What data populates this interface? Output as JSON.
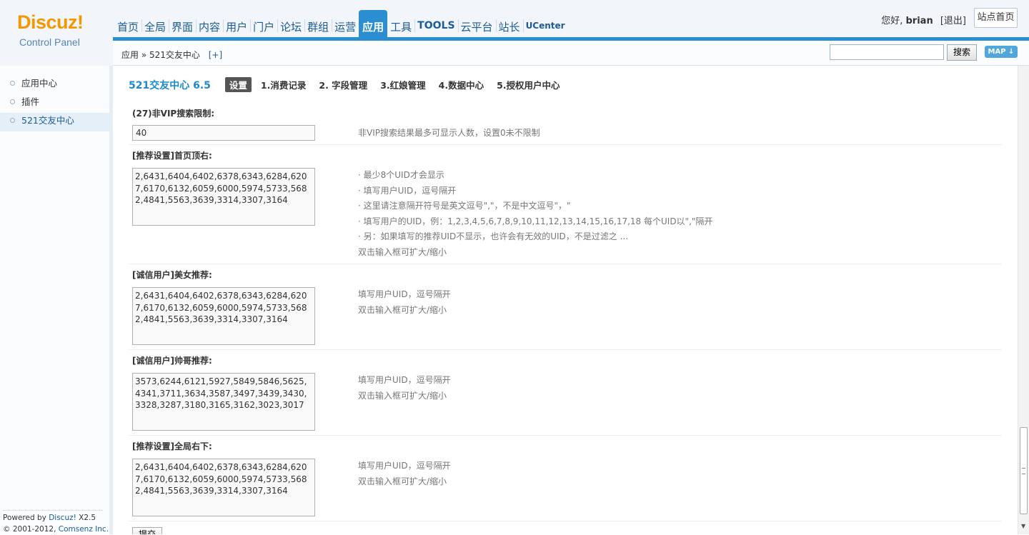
{
  "logo": {
    "brand": "Discuz!",
    "subtitle": "Control Panel"
  },
  "nav": {
    "items": [
      {
        "label": "首页"
      },
      {
        "label": "全局"
      },
      {
        "label": "界面"
      },
      {
        "label": "内容"
      },
      {
        "label": "用户"
      },
      {
        "label": "门户"
      },
      {
        "label": "论坛"
      },
      {
        "label": "群组"
      },
      {
        "label": "运营"
      },
      {
        "label": "应用"
      },
      {
        "label": "工具"
      },
      {
        "label": "TOOLS"
      },
      {
        "label": "云平台"
      },
      {
        "label": "站长"
      },
      {
        "label": "UCenter"
      }
    ],
    "active": "应用"
  },
  "user": {
    "greeting": "您好,",
    "name": "brian",
    "logout": "[退出]",
    "site_home": "站点首页"
  },
  "breadcrumb": {
    "section": "应用",
    "sep": "»",
    "current": "521交友中心",
    "add": "[+]"
  },
  "search": {
    "value": "",
    "button": "搜索"
  },
  "map_label": "MAP ↓",
  "sidebar": {
    "items": [
      {
        "label": "应用中心"
      },
      {
        "label": "插件"
      },
      {
        "label": "521交友中心"
      }
    ],
    "active_index": 2
  },
  "footer": {
    "powered": "Powered by",
    "product": "Discuz!",
    "version": "X2.5",
    "copyright": "© 2001-2012,",
    "company": "Comsenz Inc."
  },
  "plugin": {
    "title": "521交友中心 6.5",
    "tabs": [
      {
        "label": "设置"
      },
      {
        "label": "1.消费记录"
      },
      {
        "label": "2. 字段管理"
      },
      {
        "label": "3.红娘管理"
      },
      {
        "label": "4.数据中心"
      },
      {
        "label": "5.授权用户中心"
      }
    ]
  },
  "settings": [
    {
      "title": "(27)非VIP搜索限制:",
      "value": "40",
      "tips": [
        "非VIP搜索结果最多可显示人数，设置0未不限制"
      ]
    },
    {
      "title": "[推荐设置]首页顶右:",
      "value": "2,6431,6404,6402,6378,6343,6284,6207,6170,6132,6059,6000,5974,5733,5682,4841,5563,3639,3314,3307,3164",
      "tips": [
        "· 最少8个UID才会显示",
        "· 填写用户UID，逗号隔开",
        "· 这里请注意隔开符号是英文逗号\",\"，不是中文逗号\"，\"",
        "· 填写用户的UID，例：1,2,3,4,5,6,7,8,9,10,11,12,13,14,15,16,17,18 每个UID以\",\"隔开",
        "· 另：如果填写的推荐UID不显示，也许会有无效的UID，不是过滤之 ...",
        "双击输入框可扩大/缩小"
      ]
    },
    {
      "title": "[诚信用户]美女推荐:",
      "value": "2,6431,6404,6402,6378,6343,6284,6207,6170,6132,6059,6000,5974,5733,5682,4841,5563,3639,3314,3307,3164",
      "tips": [
        "填写用户UID，逗号隔开",
        "双击输入框可扩大/缩小"
      ]
    },
    {
      "title": "[诚信用户]帅哥推荐:",
      "value": "3573,6244,6121,5927,5849,5846,5625,4341,3711,3634,3587,3497,3439,3430,3328,3287,3180,3165,3162,3023,3017",
      "tips": [
        "填写用户UID，逗号隔开",
        "双击输入框可扩大/缩小"
      ]
    },
    {
      "title": "[推荐设置]全局右下:",
      "value": "2,6431,6404,6402,6378,6343,6284,6207,6170,6132,6059,6000,5974,5733,5682,4841,5563,3639,3314,3307,3164",
      "tips": [
        "填写用户UID，逗号隔开",
        "双击输入框可扩大/缩小"
      ]
    }
  ],
  "submit_label": "提交"
}
